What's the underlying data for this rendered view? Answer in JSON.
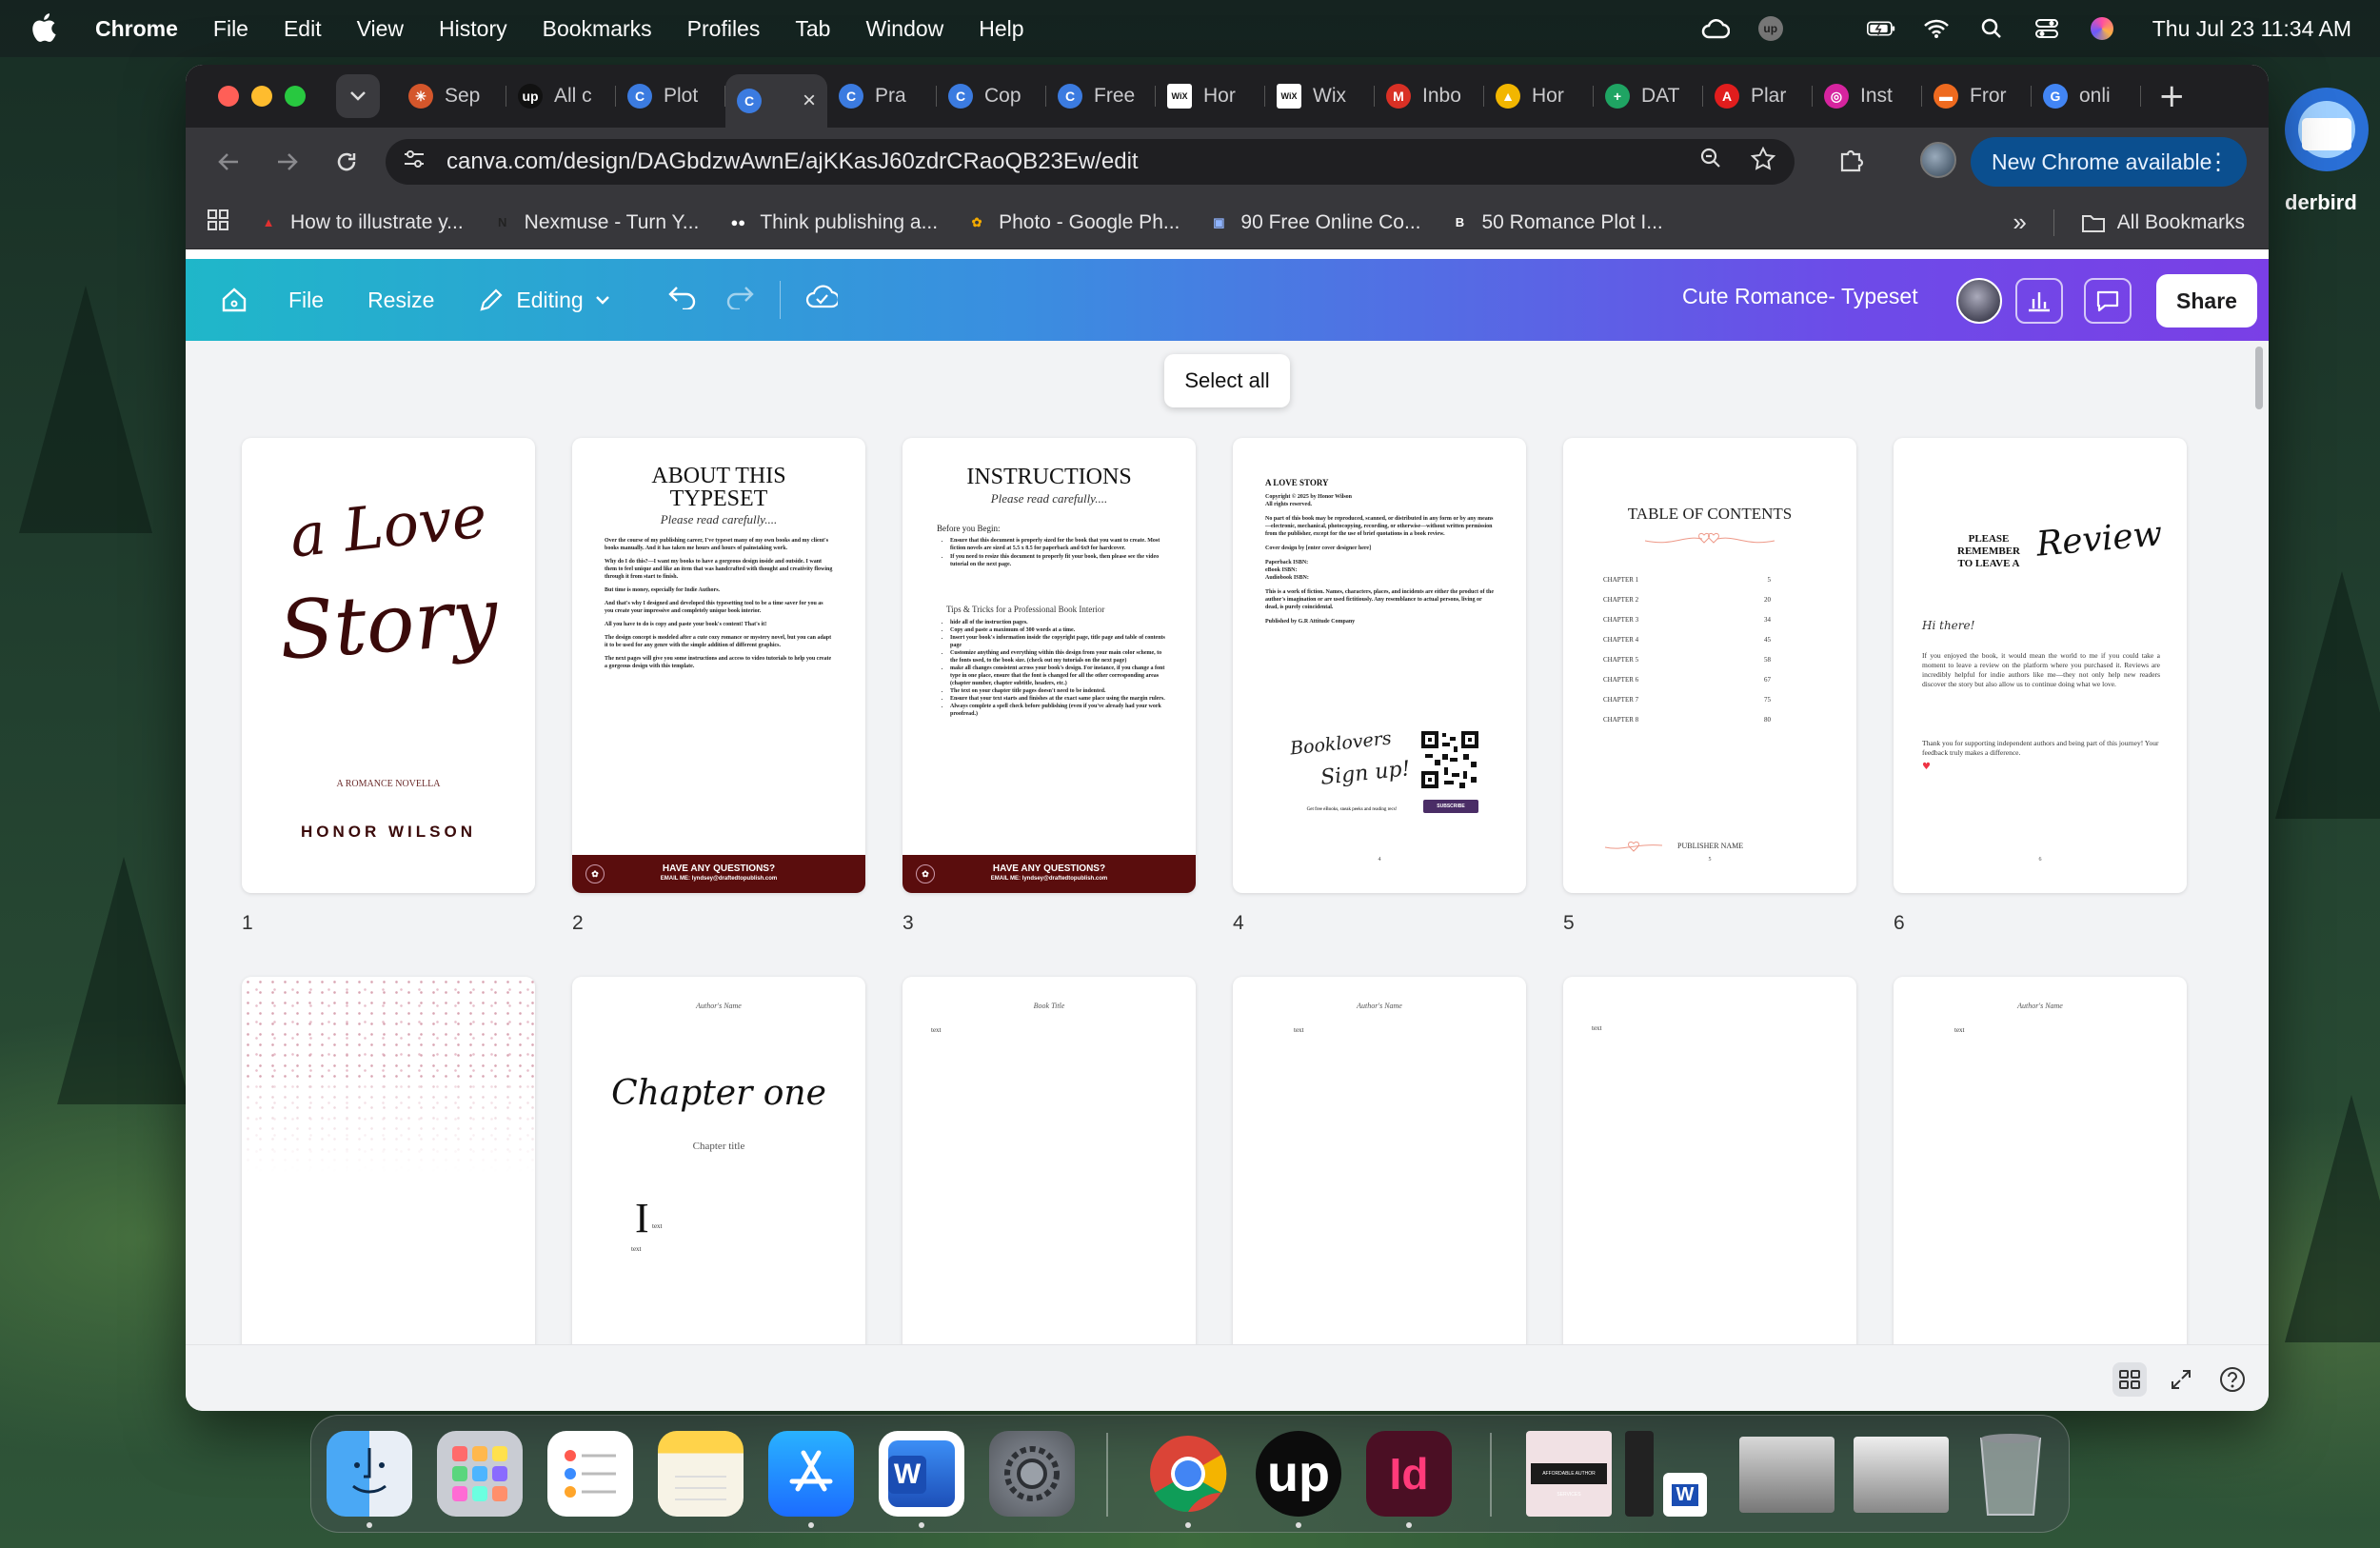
{
  "menubar": {
    "app": "Chrome",
    "items": [
      "File",
      "Edit",
      "View",
      "History",
      "Bookmarks",
      "Profiles",
      "Tab",
      "Window",
      "Help"
    ],
    "clock": "Thu Jul 23  11:34 AM"
  },
  "tabs": [
    {
      "label": "Sep",
      "fav": "✳",
      "color": "#d4562b"
    },
    {
      "label": "All c",
      "fav": "up",
      "color": "#111111"
    },
    {
      "label": "Plot",
      "fav": "C",
      "color": "#3b7be0"
    },
    {
      "label": "",
      "fav": "C",
      "color": "#3b7be0",
      "active": true
    },
    {
      "label": "Pra",
      "fav": "C",
      "color": "#3b7be0"
    },
    {
      "label": "Cop",
      "fav": "C",
      "color": "#3b7be0"
    },
    {
      "label": "Free",
      "fav": "C",
      "color": "#3b7be0"
    },
    {
      "label": "Hor",
      "fav": "WiX",
      "color": "#ffffff"
    },
    {
      "label": "Wix",
      "fav": "WiX",
      "color": "#ffffff"
    },
    {
      "label": "Inbo",
      "fav": "M",
      "color": "#d93025"
    },
    {
      "label": "Hor",
      "fav": "▲",
      "color": "#f2b600"
    },
    {
      "label": "DAT",
      "fav": "+",
      "color": "#1fa463"
    },
    {
      "label": "Plar",
      "fav": "A",
      "color": "#e11d1d"
    },
    {
      "label": "Inst",
      "fav": "◎",
      "color": "#d6249f"
    },
    {
      "label": "Fror",
      "fav": "▬",
      "color": "#ee6a1f"
    },
    {
      "label": "onli",
      "fav": "G",
      "color": "#4285f4"
    }
  ],
  "address": {
    "url": "canva.com/design/DAGbdzwAwnE/ajKKasJ60zdrCRaoQB23Ew/edit",
    "update_button": "New Chrome available"
  },
  "bookmarks": [
    {
      "label": "How to illustrate y...",
      "icon": "▲",
      "color": "#e03030"
    },
    {
      "label": "Nexmuse - Turn Y...",
      "icon": "N",
      "color": "#222222"
    },
    {
      "label": "Think publishing a...",
      "icon": "●●",
      "color": "#ffffff"
    },
    {
      "label": "Photo - Google Ph...",
      "icon": "✿",
      "color": "#f2a900"
    },
    {
      "label": "90 Free Online Co...",
      "icon": "▣",
      "color": "#8fb4ff"
    },
    {
      "label": "50 Romance Plot I...",
      "icon": "B",
      "color": "#ffffff"
    }
  ],
  "bookmarks_all": "All Bookmarks",
  "canva": {
    "file": "File",
    "resize": "Resize",
    "editing": "Editing",
    "doc_title": "Cute Romance- Typeset",
    "share": "Share",
    "select_all": "Select all"
  },
  "pages": {
    "p1": {
      "num": "1",
      "title_a": "a Love",
      "title_b": "Story",
      "sub": "A ROMANCE NOVELLA",
      "author": "HONOR WILSON"
    },
    "p2": {
      "num": "2",
      "title": "ABOUT THIS TYPESET",
      "script": "Please read carefully....",
      "banner": "HAVE ANY QUESTIONS?",
      "email": "EMAIL ME: lyndsey@draftedtopublish.com",
      "paras": [
        "Over the course of my publishing career, I've typeset many of my own books and my client's books manually. And it has taken me hours and hours of painstaking work.",
        "Why do I do this?—I want my books to have a gorgeous design inside and outside. I want them to feel unique and like an item that was handcrafted with thought and creativity flowing through it from start to finish.",
        "But time is money, especially for Indie Authors.",
        "And that's why I designed and developed this typesetting tool to be a time saver for you as you create your impressive and completely unique book interior.",
        "All you have to do is copy and paste your book's content! That's it!",
        "The design concept is modeled after a cute cozy romance or mystery novel, but you can adapt it to be used for any genre with the simple addition of different graphics.",
        "The next pages will give you some instructions and access to video tutorials to help you create a gorgeous design with this template."
      ]
    },
    "p3": {
      "num": "3",
      "title": "INSTRUCTIONS",
      "script": "Please read carefully....",
      "before": "Before you Begin:",
      "banner": "HAVE ANY QUESTIONS?",
      "email": "EMAIL ME: lyndsey@draftedtopublish.com",
      "before_items": [
        "Ensure that this document is properly sized for the book that you want to create. Most fiction novels are sized at 5.5 x 8.5 for paperback and 6x9 for hardcover.",
        "If you need to resize this document to properly fit your book, then please see the video tutorial on the next page."
      ],
      "tips_title": "Tips & Tricks for a Professional Book Interior",
      "tips": [
        "hide all of the instruction pages.",
        "Copy and paste a maximum of 300 words at a time.",
        "Insert your book's information inside the copyright page, title page and table of contents page",
        "Customize anything and everything within this design from your main color scheme, to the fonts used, to the book size. (check out my tutorials on the next page)",
        "make all changes consistent across your book's design. For instance, if you change a font type in one place, ensure that the font is changed for all the other corresponding areas (chapter number, chapter subtitle, headers, etc.)",
        "The text on your chapter title pages doesn't need to be indented.",
        "Ensure that your text starts and finishes at the exact same place using the margin rulers.",
        "Always complete a spell check before publishing (even if you've already had your work proofread.)"
      ]
    },
    "p4": {
      "num": "4",
      "heading": "A LOVE STORY",
      "lines": [
        "Copyright © 2025 by Honor Wilson",
        "All rights reserved."
      ],
      "body": "No part of this book may be reproduced, scanned, or distributed in any form or by any means—electronic, mechanical, photocopying, recording, or otherwise—without written permission from the publisher, except for the use of brief quotations in a book review.",
      "cover": "Cover design by [enter cover designer here]",
      "isbn": [
        "Paperback ISBN:",
        "eBook ISBN:",
        "Audiobook ISBN:"
      ],
      "fiction": "This is a work of fiction. Names, characters, places, and incidents are either the product of the author's imagination or are used fictitiously. Any resemblance to actual persons, living or dead, is purely coincidental.",
      "publisher": "Published by G.R Attitude Company",
      "signup_a": "Booklovers",
      "signup_b": "Sign up!",
      "signup_sub": "Get free eBooks, sneak peeks and reading recs!",
      "subscribe": "SUBSCRIBE",
      "pageno": "4"
    },
    "p5": {
      "num": "5",
      "title": "TABLE OF CONTENTS",
      "chapters": [
        {
          "name": "CHAPTER 1",
          "page": "5"
        },
        {
          "name": "CHAPTER 2",
          "page": "20"
        },
        {
          "name": "CHAPTER 3",
          "page": "34"
        },
        {
          "name": "CHAPTER 4",
          "page": "45"
        },
        {
          "name": "CHAPTER 5",
          "page": "58"
        },
        {
          "name": "CHAPTER 6",
          "page": "67"
        },
        {
          "name": "CHAPTER 7",
          "page": "75"
        },
        {
          "name": "CHAPTER 8",
          "page": "80"
        }
      ],
      "publisher": "PUBLISHER NAME",
      "pageno": "5"
    },
    "p6": {
      "num": "6",
      "please": "PLEASE REMEMBER TO LEAVE A",
      "review": "Review",
      "greet": "Hi there!",
      "para1": "If you enjoyed the book, it would mean the world to me if you could take a moment to leave a review on the platform where you purchased it. Reviews are incredibly helpful for indie authors like me—they not only help new readers discover the story but also allow us to continue doing what we love.",
      "para2": "Thank you for supporting independent authors and being part of this journey! Your feedback truly makes a difference.",
      "pageno": "6"
    },
    "p8": {
      "header": "Author's Name",
      "chapter": "Chapter one",
      "subtitle": "Chapter title",
      "dropcap": "I",
      "text1": "text",
      "text2": "text"
    },
    "p9": {
      "header": "Book Title",
      "text": "text"
    },
    "p10": {
      "header": "Author's Name",
      "text": "text"
    },
    "p11": {
      "text": "text"
    },
    "p12": {
      "header": "Author's Name",
      "text": "text"
    }
  },
  "dock_apps": [
    "Finder",
    "Launchpad",
    "Reminders",
    "Notes",
    "App Store",
    "Microsoft Word",
    "System Settings",
    "Google Chrome",
    "Upwork",
    "Adobe InDesign"
  ],
  "dock_doc_label": "AFFORDABLE AUTHOR SERVICES",
  "desktop_label": "derbird"
}
